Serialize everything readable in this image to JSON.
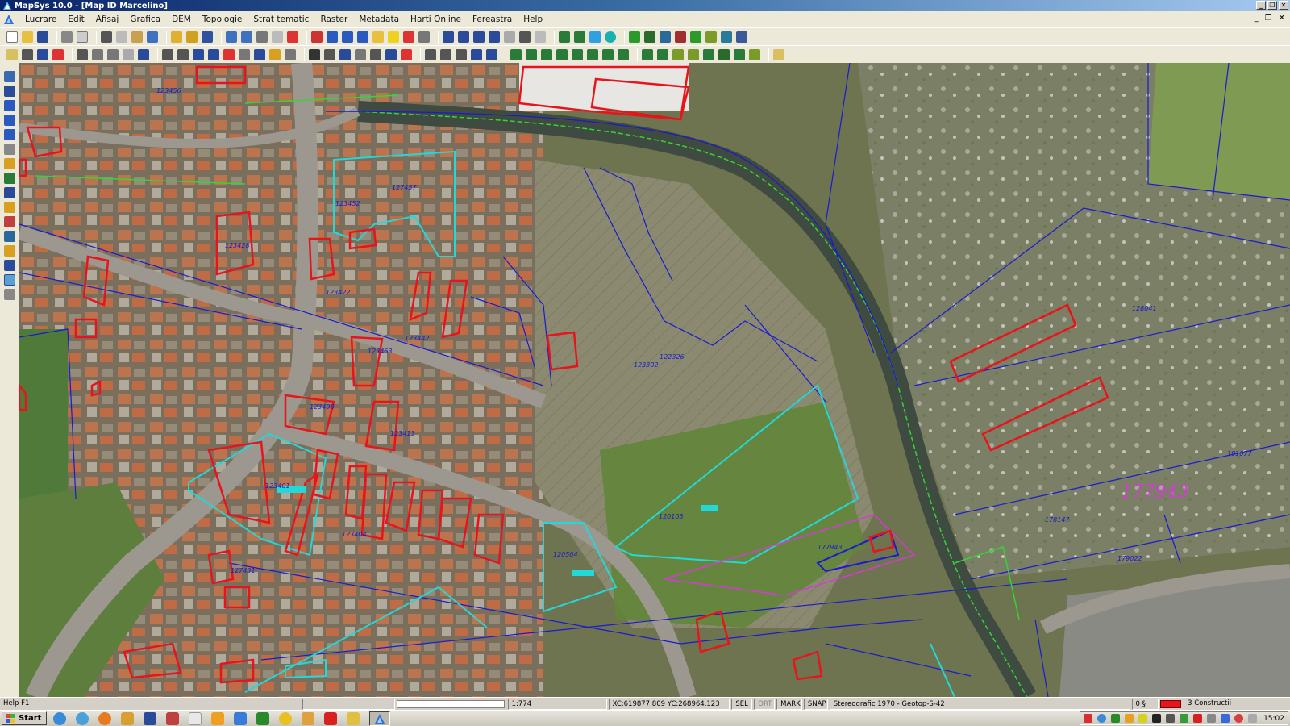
{
  "window": {
    "title": "MapSys 10.0 - [Map ID Marcelino]",
    "buttons": [
      "_",
      "❐",
      "✕"
    ],
    "mdi_buttons": [
      "_",
      "❐",
      "✕"
    ]
  },
  "menu": [
    "Lucrare",
    "Edit",
    "Afisaj",
    "Grafica",
    "DEM",
    "Topologie",
    "Strat tematic",
    "Raster",
    "Metadata",
    "Harti Online",
    "Fereastra",
    "Help"
  ],
  "colors": {
    "parcel_blue": "#1a1ad0",
    "building_red": "#e8141b",
    "cyan": "#22d8d8",
    "magenta": "#d63ad6",
    "green": "#33d633"
  },
  "map": {
    "parcel_labels": [
      "123456",
      "127457",
      "123452",
      "123422",
      "123428",
      "123442",
      "123463",
      "123498",
      "123413",
      "123401",
      "123404",
      "127431",
      "122326",
      "123302",
      "120103",
      "120504",
      "177943",
      "178147",
      "179022",
      "181077",
      "128041"
    ],
    "big_label": "177943"
  },
  "status": {
    "help": "Help F1",
    "scale": "1:774",
    "coords": "XC:619877.809 YC:268964.123",
    "sel": "SEL",
    "ort": "ORT",
    "mark": "MARK",
    "snap": "SNAP",
    "projection": "Stereografic 1970 - Geotop-S-42",
    "count": "0 §",
    "layer": "3 Constructii"
  },
  "taskbar": {
    "start_label": "Start",
    "clock": "15:02"
  }
}
